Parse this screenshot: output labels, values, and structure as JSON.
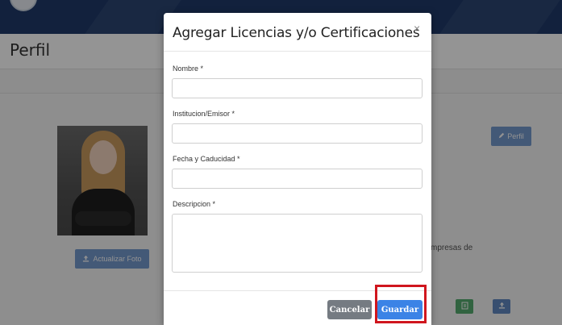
{
  "page": {
    "title": "Perfil",
    "update_photo_label": "Actualizar Foto",
    "perfil_button_label": "Perfil",
    "partial_text": "mpresas  de"
  },
  "icons": {
    "upload": "upload-icon",
    "pencil": "pencil-icon",
    "document": "document-icon",
    "close": "close-icon"
  },
  "colors": {
    "header_navy": "#1f3a6a",
    "primary_blue": "#3b83e6",
    "cancel_gray": "#757b82",
    "success_green": "#2e9a4e",
    "highlight_red": "#d0161e"
  },
  "modal": {
    "title": "Agregar Licencias y/o Certificaciones",
    "close_symbol": "×",
    "fields": {
      "nombre": {
        "label": "Nombre *",
        "value": "",
        "placeholder": ""
      },
      "institucion": {
        "label": "Institucion/Emisor *",
        "value": "",
        "placeholder": ""
      },
      "fecha": {
        "label": "Fecha y Caducidad *",
        "value": "",
        "placeholder": ""
      },
      "descripcion": {
        "label": "Descripcion *",
        "value": "",
        "placeholder": ""
      }
    },
    "cancel_label": "Cancelar",
    "save_label": "Guardar"
  }
}
